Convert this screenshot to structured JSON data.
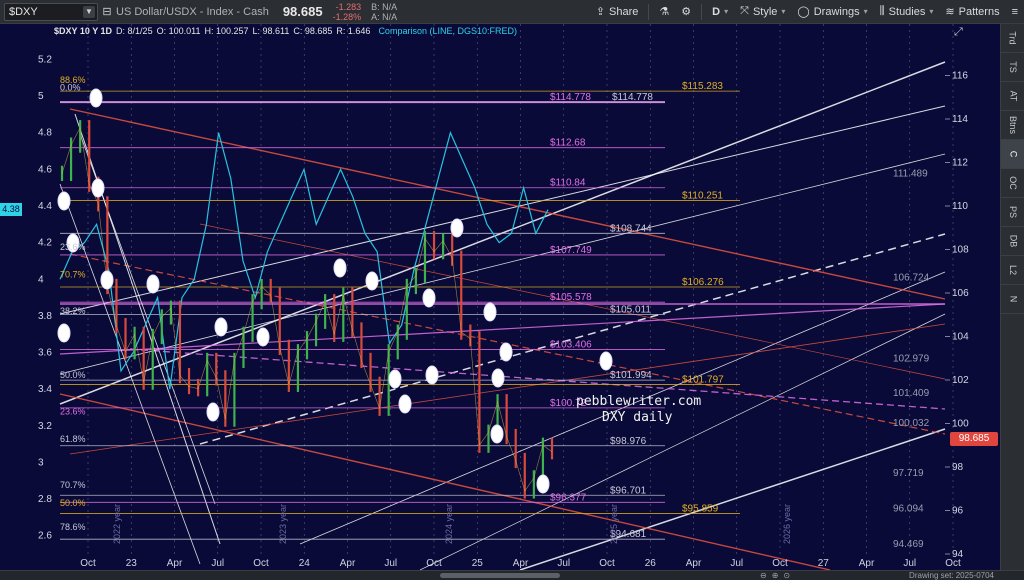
{
  "toolbar": {
    "symbol": "$DXY",
    "name": "US Dollar/USDX - Index - Cash",
    "price": "98.685",
    "change": "-1.283",
    "change_pct": "-1.28%",
    "bid": "B: N/A",
    "ask": "A: N/A",
    "share_label": "Share",
    "interval_label": "D",
    "style_label": "Style",
    "drawings_label": "Drawings",
    "studies_label": "Studies",
    "patterns_label": "Patterns"
  },
  "chart_header": {
    "symbol_period": "$DXY 10 Y 1D",
    "date": "D: 8/1/25",
    "open": "O: 100.011",
    "high": "H: 100.257",
    "low": "L: 98.611",
    "close": "C: 98.685",
    "range": "R: 1.646",
    "comparison": "Comparison (LINE, DGS10:FRED)"
  },
  "watermark": {
    "line1": "pebblewriter.com",
    "line2": "DXY daily"
  },
  "current_price_tag": "98.685",
  "left_price_tag": "4.38",
  "sidebar": [
    "Trd",
    "TS",
    "AT",
    "Btns",
    "C",
    "OC",
    "PS",
    "DB",
    "L2",
    "N"
  ],
  "bottom": {
    "drawing_set": "Drawing set: 2025-0704"
  },
  "colors": {
    "background": "#0a0a38",
    "price_line": "#27c3e0",
    "up_bar": "#3fb24b",
    "down_bar": "#d94a3a",
    "fib_magenta": "#e070e6",
    "fib_gold": "#e0b020",
    "channel_red": "#e8543f",
    "channel_white": "#ffffff",
    "grid": "#5a5a80"
  },
  "chart_data": {
    "type": "line",
    "x_axis": {
      "ticks": [
        "Oct",
        "23",
        "Apr",
        "Jul",
        "Oct",
        "24",
        "Apr",
        "Jul",
        "Oct",
        "25",
        "Apr",
        "Jul",
        "Oct",
        "26",
        "Apr",
        "Jul",
        "Oct",
        "27",
        "Apr",
        "Jul",
        "Oct"
      ]
    },
    "year_markers": [
      "2022 year",
      "2023 year",
      "2024 year",
      "2025 year",
      "2026 year"
    ],
    "right_axis": {
      "ylim": [
        94,
        118
      ],
      "ticks": [
        94,
        96,
        98,
        100,
        102,
        104,
        106,
        108,
        110,
        112,
        114,
        116
      ]
    },
    "left_axis": {
      "ylim": [
        2.5,
        5.35
      ],
      "ticks": [
        2.6,
        2.8,
        3,
        3.2,
        3.4,
        3.6,
        3.8,
        4,
        4.2,
        4.4,
        4.6,
        4.8,
        5,
        5.2
      ]
    },
    "right_price_labels": [
      "111.489",
      "106.724",
      "102.979",
      "101.409",
      "100.032",
      "97.719",
      "96.094",
      "94.469"
    ],
    "fib_levels": [
      {
        "value": 115.283,
        "label": "$115.283",
        "color": "gold"
      },
      {
        "value": 114.778,
        "label": "$114.778",
        "color": "magenta"
      },
      {
        "value": 114.778,
        "label": "$114.778",
        "color": "white"
      },
      {
        "value": 112.68,
        "label": "$112.68",
        "color": "magenta"
      },
      {
        "value": 110.84,
        "label": "$110.84",
        "color": "magenta"
      },
      {
        "value": 110.251,
        "label": "$110.251",
        "color": "gold"
      },
      {
        "value": 108.744,
        "label": "$108.744",
        "color": "white"
      },
      {
        "value": 107.749,
        "label": "$107.749",
        "color": "magenta"
      },
      {
        "value": 106.276,
        "label": "$106.276",
        "color": "gold"
      },
      {
        "value": 105.578,
        "label": "$105.578",
        "color": "magenta"
      },
      {
        "value": 105.011,
        "label": "$105.011",
        "color": "white"
      },
      {
        "value": 103.406,
        "label": "$103.406",
        "color": "magenta"
      },
      {
        "value": 101.994,
        "label": "$101.994",
        "color": "white"
      },
      {
        "value": 101.797,
        "label": "$101.797",
        "color": "gold"
      },
      {
        "value": 100.72,
        "label": "$100.72",
        "color": "magenta"
      },
      {
        "value": 98.976,
        "label": "$98.976",
        "color": "white"
      },
      {
        "value": 96.701,
        "label": "$96.701",
        "color": "white"
      },
      {
        "value": 96.377,
        "label": "$96.377",
        "color": "magenta"
      },
      {
        "value": 95.859,
        "label": "$95.859",
        "color": "gold"
      },
      {
        "value": 94.681,
        "label": "$94.681",
        "color": "white"
      }
    ],
    "left_fib_labels": [
      {
        "y": 5.02,
        "label": "0.0%",
        "color": "white"
      },
      {
        "y": 5.06,
        "label": "88.6%",
        "color": "gold"
      },
      {
        "y": 4.15,
        "label": "23.6%",
        "color": "white"
      },
      {
        "y": 4.0,
        "label": "70.7%",
        "color": "gold"
      },
      {
        "y": 3.8,
        "label": "38.2%",
        "color": "white"
      },
      {
        "y": 3.45,
        "label": "50.0%",
        "color": "white"
      },
      {
        "y": 3.25,
        "label": "23.6%",
        "color": "magenta"
      },
      {
        "y": 3.1,
        "label": "61.8%",
        "color": "white"
      },
      {
        "y": 2.85,
        "label": "70.7%",
        "color": "white"
      },
      {
        "y": 2.75,
        "label": "50.0%",
        "color": "gold"
      },
      {
        "y": 2.62,
        "label": "78.6%",
        "color": "white"
      }
    ],
    "series": [
      {
        "name": "$DXY",
        "axis": "right",
        "values": [
          111.5,
          112.8,
          113.6,
          111.0,
          110.1,
          106.3,
          104.5,
          103.3,
          104.1,
          101.9,
          104.0,
          104.9,
          105.3,
          102.2,
          101.7,
          101.6,
          102.9,
          102.1,
          100.2,
          102.9,
          104.1,
          105.6,
          106.3,
          105.9,
          103.5,
          101.8,
          103.3,
          103.9,
          104.7,
          105.6,
          104.1,
          105.9,
          104.3,
          102.9,
          101.8,
          100.7,
          103.3,
          104.2,
          106.3,
          106.8,
          108.5,
          107.9,
          108.4,
          107.6,
          104.2,
          103.9,
          99.0,
          99.6,
          101.0,
          99.4,
          98.3,
          96.9,
          97.5,
          99.0,
          98.7
        ]
      },
      {
        "name": "DGS10:FRED",
        "axis": "left",
        "values": [
          4.0,
          4.15,
          4.2,
          4.3,
          4.05,
          3.5,
          3.6,
          3.75,
          3.9,
          3.4,
          3.9,
          4.0,
          4.3,
          4.8,
          4.55,
          4.1,
          3.9,
          4.15,
          4.3,
          4.45,
          4.6,
          4.3,
          4.45,
          4.6,
          4.45,
          4.25,
          4.15,
          3.65,
          3.75,
          4.05,
          4.3,
          4.55,
          4.8,
          4.65,
          4.5,
          4.3,
          4.2,
          4.25,
          4.5,
          4.25,
          4.38
        ]
      }
    ]
  }
}
